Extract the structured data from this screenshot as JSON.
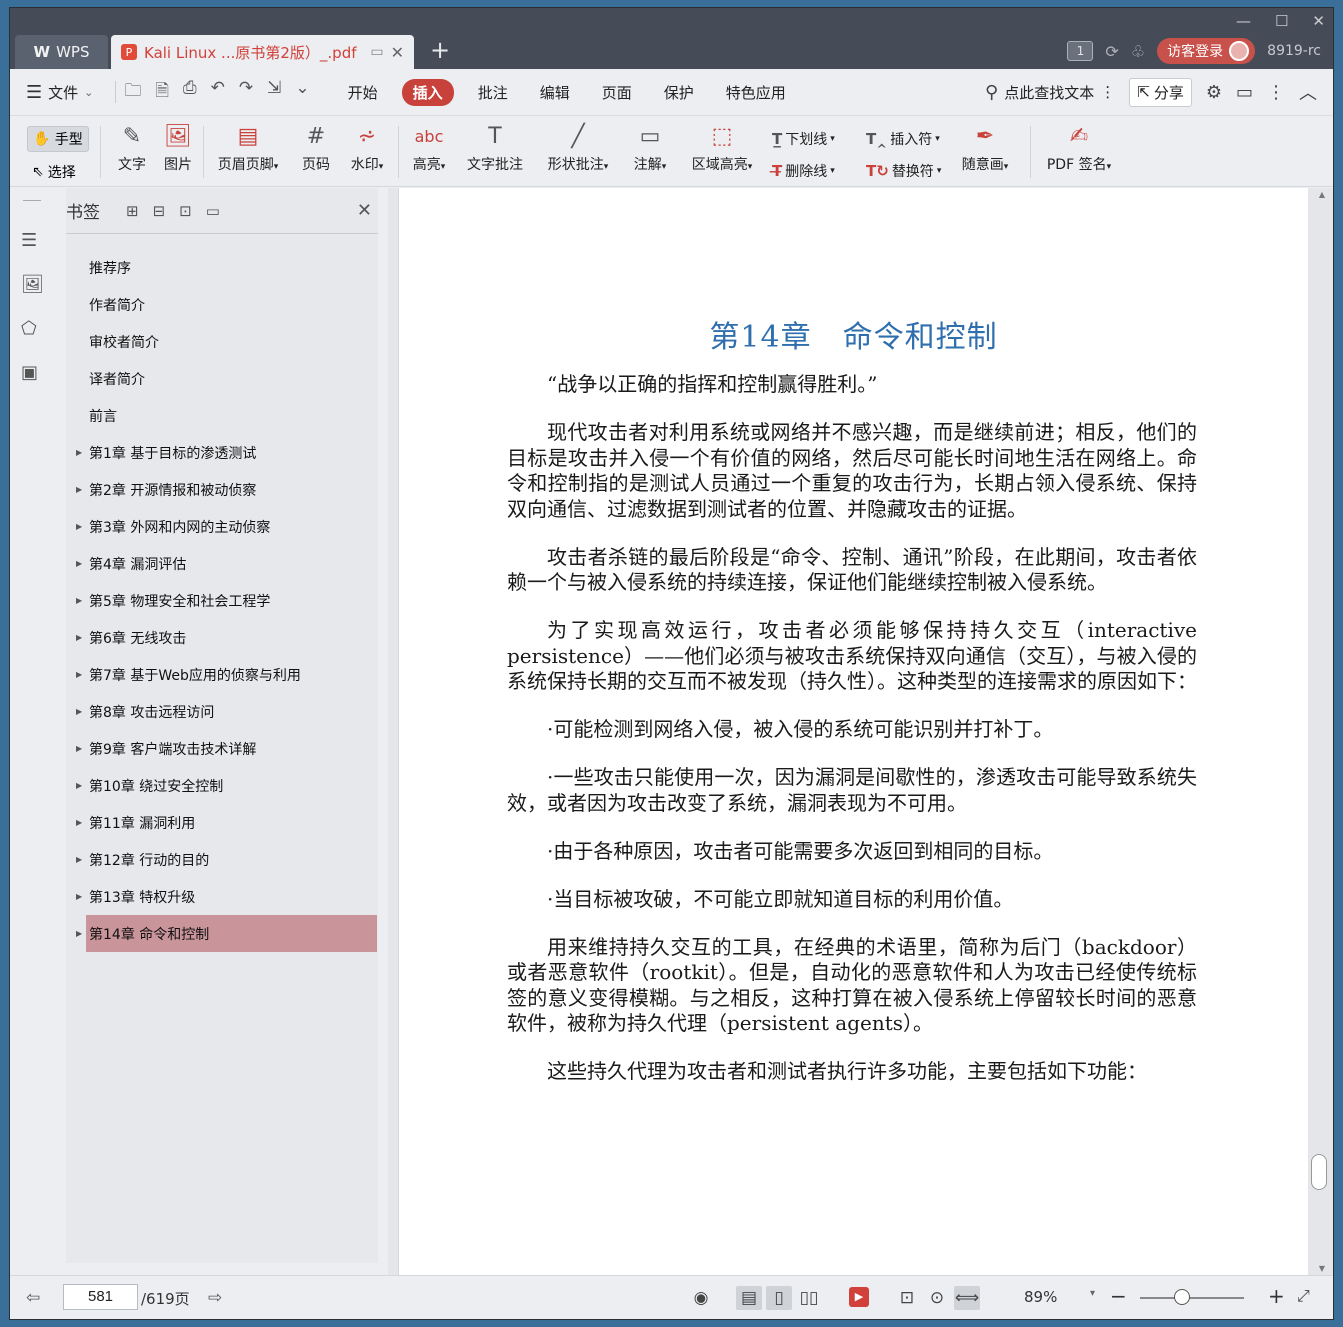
{
  "titlebar": {
    "app_tab": "WPS",
    "doc_tab_title": "Kali Linux ...原书第2版）_.pdf",
    "page_badge": "1",
    "login_button": "访客登录",
    "version": "8919-rc"
  },
  "menubar": {
    "file": "文件",
    "items": [
      "开始",
      "插入",
      "批注",
      "编辑",
      "页面",
      "保护",
      "特色应用"
    ],
    "active": "插入",
    "search": "点此查找文本",
    "share": "分享"
  },
  "ribbon": {
    "hand": "手型",
    "select": "选择",
    "text": "文字",
    "image": "图片",
    "header_footer": "页眉页脚",
    "page_number": "页码",
    "watermark": "水印",
    "highlight": "高亮",
    "text_note": "文字批注",
    "shape_note": "形状批注",
    "annotation": "注解",
    "area_highlight": "区域高亮",
    "underline": "下划线",
    "strikethrough": "删除线",
    "insert_mark": "插入符",
    "replace_mark": "替换符",
    "freehand": "随意画",
    "pdf_sign": "PDF 签名"
  },
  "bookmarks": {
    "title": "书签",
    "items": [
      {
        "label": "推荐序",
        "expandable": false
      },
      {
        "label": "作者简介",
        "expandable": false
      },
      {
        "label": "审校者简介",
        "expandable": false
      },
      {
        "label": "译者简介",
        "expandable": false
      },
      {
        "label": "前言",
        "expandable": false
      },
      {
        "label": "第1章 基于目标的渗透测试",
        "expandable": true
      },
      {
        "label": "第2章 开源情报和被动侦察",
        "expandable": true
      },
      {
        "label": "第3章 外网和内网的主动侦察",
        "expandable": true
      },
      {
        "label": "第4章 漏洞评估",
        "expandable": true
      },
      {
        "label": "第5章 物理安全和社会工程学",
        "expandable": true
      },
      {
        "label": "第6章 无线攻击",
        "expandable": true
      },
      {
        "label": "第7章 基于Web应用的侦察与利用",
        "expandable": true
      },
      {
        "label": "第8章 攻击远程访问",
        "expandable": true
      },
      {
        "label": "第9章 客户端攻击技术详解",
        "expandable": true
      },
      {
        "label": "第10章 绕过安全控制",
        "expandable": true
      },
      {
        "label": "第11章 漏洞利用",
        "expandable": true
      },
      {
        "label": "第12章 行动的目的",
        "expandable": true
      },
      {
        "label": "第13章 特权升级",
        "expandable": true
      },
      {
        "label": "第14章 命令和控制",
        "expandable": true
      }
    ],
    "active_index": 18
  },
  "document": {
    "chapter_title": "第14章　命令和控制",
    "paragraphs": [
      "“战争以正确的指挥和控制赢得胜利。”",
      "现代攻击者对利用系统或网络并不感兴趣，而是继续前进；相反，他们的目标是攻击并入侵一个有价值的网络，然后尽可能长时间地生活在网络上。命令和控制指的是测试人员通过一个重复的攻击行为，长期占领入侵系统、保持双向通信、过滤数据到测试者的位置、并隐藏攻击的证据。",
      "攻击者杀链的最后阶段是“命令、控制、通讯”阶段，在此期间，攻击者依赖一个与被入侵系统的持续连接，保证他们能继续控制被入侵系统。",
      "为了实现高效运行，攻击者必须能够保持持久交互（interactive persistence）——他们必须与被攻击系统保持双向通信（交互），与被入侵的系统保持长期的交互而不被发现（持久性）。这种类型的连接需求的原因如下：",
      "·可能检测到网络入侵，被入侵的系统可能识别并打补丁。",
      "·一些攻击只能使用一次，因为漏洞是间歇性的，渗透攻击可能导致系统失效，或者因为攻击改变了系统，漏洞表现为不可用。",
      "·由于各种原因，攻击者可能需要多次返回到相同的目标。",
      "·当目标被攻破，不可能立即就知道目标的利用价值。",
      "用来维持持久交互的工具，在经典的术语里，简称为后门（backdoor）或者恶意软件（rootkit）。但是，自动化的恶意软件和人为攻击已经使传统标签的意义变得模糊。与之相反，这种打算在被入侵系统上停留较长时间的恶意软件，被称为持久代理（persistent agents）。",
      "这些持久代理为攻击者和测试者执行许多功能，主要包括如下功能："
    ]
  },
  "statusbar": {
    "current_page": "581",
    "total_pages": "/619页",
    "zoom": "89%",
    "zoom_level_fraction": 0.4
  },
  "colors": {
    "accent": "#c9413b",
    "title_blue": "#2f6fae",
    "active_bookmark": "#c9959a"
  }
}
